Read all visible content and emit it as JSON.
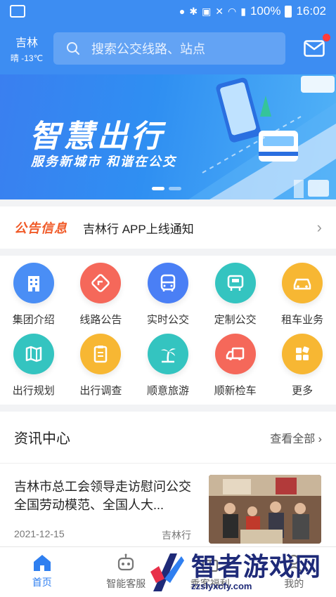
{
  "status_bar": {
    "battery": "100%",
    "time": "16:02"
  },
  "header": {
    "city": "吉林",
    "weather": "晴 -13℃",
    "search_placeholder": "搜索公交线路、站点"
  },
  "banner": {
    "title": "智慧出行",
    "subtitle": "服务新城市 和谐在公交",
    "page_count": 2,
    "active_page": 1
  },
  "notice": {
    "tag": "公告信息",
    "text": "吉林行 APP上线通知"
  },
  "services": [
    {
      "label": "集团介绍",
      "icon": "building-icon",
      "color": "#4a8ef5"
    },
    {
      "label": "线路公告",
      "icon": "route-sign-icon",
      "color": "#f5685a"
    },
    {
      "label": "实时公交",
      "icon": "bus-icon",
      "color": "#4a7ff5"
    },
    {
      "label": "定制公交",
      "icon": "bus-stop-icon",
      "color": "#34c4c0"
    },
    {
      "label": "租车业务",
      "icon": "car-icon",
      "color": "#f7b733"
    },
    {
      "label": "出行规划",
      "icon": "map-icon",
      "color": "#34c4c0"
    },
    {
      "label": "出行调查",
      "icon": "clipboard-icon",
      "color": "#f7b733"
    },
    {
      "label": "顺意旅游",
      "icon": "palm-tree-icon",
      "color": "#34c4c0"
    },
    {
      "label": "顺新检车",
      "icon": "truck-icon",
      "color": "#f5685a"
    },
    {
      "label": "更多",
      "icon": "more-grid-icon",
      "color": "#f7b733"
    }
  ],
  "news": {
    "title": "资讯中心",
    "view_all": "查看全部",
    "articles": [
      {
        "title": "吉林市总工会领导走访慰问公交全国劳动模范、全国人大...",
        "date": "2021-12-15",
        "source": "吉林行"
      }
    ]
  },
  "tabs": [
    {
      "label": "首页",
      "icon": "home-icon",
      "active": true
    },
    {
      "label": "智能客服",
      "icon": "robot-icon",
      "active": false
    },
    {
      "label": "乘客福利",
      "icon": "gift-icon",
      "active": false
    },
    {
      "label": "我的",
      "icon": "user-icon",
      "active": false
    }
  ],
  "watermark": {
    "brand": "智者游戏网",
    "url": "zzslyxcfy.com"
  },
  "colors": {
    "primary": "#3d8df2",
    "accent": "#f05a28",
    "active_tab": "#2f7ff0"
  }
}
